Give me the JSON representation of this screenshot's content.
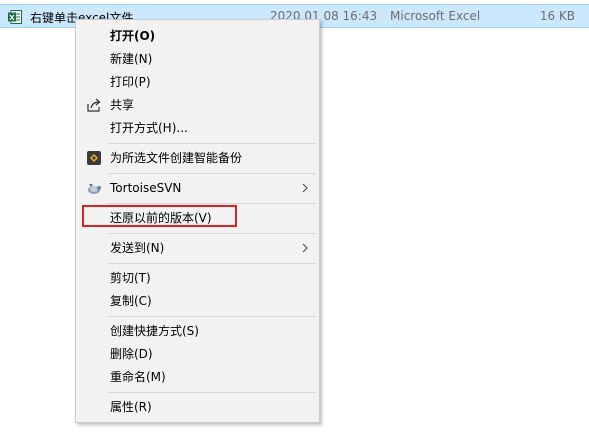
{
  "file": {
    "name": "右键单击excel文件",
    "date": "2020 01 08 16:43",
    "type": "Microsoft Excel",
    "size": "16 KB"
  },
  "menu": {
    "open": "打开(O)",
    "new": "新建(N)",
    "print": "打印(P)",
    "share": "共享",
    "open_with": "打开方式(H)...",
    "smart_backup": "为所选文件创建智能备份",
    "tortoise_svn": "TortoiseSVN",
    "restore_previous": "还原以前的版本(V)",
    "send_to": "发送到(N)",
    "cut": "剪切(T)",
    "copy": "复制(C)",
    "create_shortcut": "创建快捷方式(S)",
    "delete": "删除(D)",
    "rename": "重命名(M)",
    "properties": "属性(R)"
  },
  "colors": {
    "selection": "#cce8ff",
    "menu_bg": "#f2f2f2",
    "highlight_box": "#e02020",
    "excel_green": "#1e7145"
  },
  "icons": {
    "file": "excel-file-icon",
    "share": "share-icon",
    "smart_backup": "backup-icon",
    "tortoise_svn": "tortoisesvn-icon",
    "submenu": "chevron-right-icon"
  }
}
